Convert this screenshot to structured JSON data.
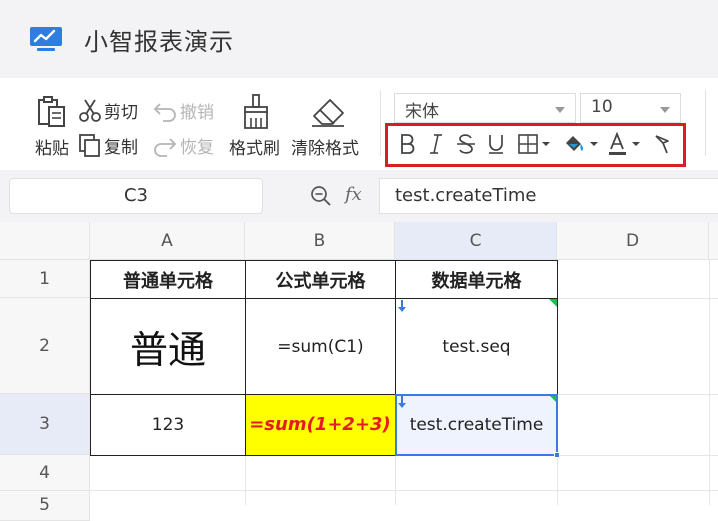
{
  "app": {
    "title": "小智报表演示",
    "icon": "presentation-chart-icon"
  },
  "toolbar": {
    "paste": "粘贴",
    "cut": "剪切",
    "copy": "复制",
    "undo": "撤销",
    "redo": "恢复",
    "format_painter": "格式刷",
    "clear_format": "清除格式",
    "font_family": "宋体",
    "font_size": "10"
  },
  "formula_bar": {
    "cell_ref": "C3",
    "fx": "fx",
    "formula": "test.createTime"
  },
  "sheet": {
    "columns": [
      "A",
      "B",
      "C",
      "D"
    ],
    "rows": [
      "1",
      "2",
      "3",
      "4",
      "5"
    ],
    "cells": {
      "A1": "普通单元格",
      "B1": "公式单元格",
      "C1": "数据单元格",
      "A2": "普通",
      "B2": "=sum(C1)",
      "C2": "test.seq",
      "A3": "123",
      "B3": "=sum(1+2+3)",
      "C3": "test.createTime"
    }
  },
  "colors": {
    "selection": "#3b7ae0",
    "highlight_border": "#d62020",
    "formula_fill": "#ffff00",
    "formula_text": "#e51c23"
  }
}
